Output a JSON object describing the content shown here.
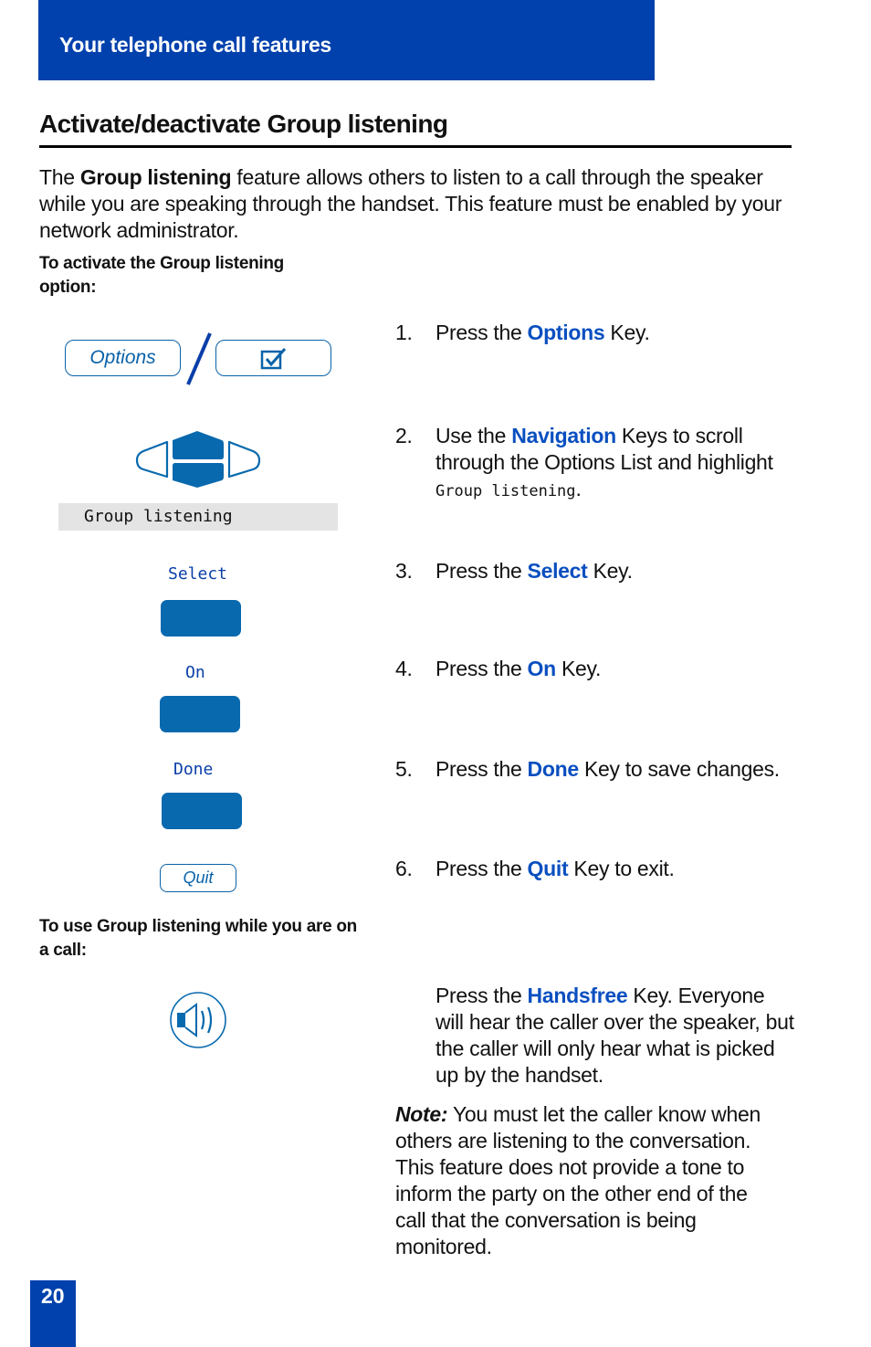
{
  "header": {
    "section": "Your telephone call features"
  },
  "page": {
    "title": "Activate/deactivate Group listening",
    "intro": {
      "pre": "The ",
      "bold": "Group listening",
      "post": " feature allows others to listen to a call through the speaker while you are speaking through the handset. This feature must be enabled by your network administrator."
    },
    "activate_heading": "To activate the Group listening option:",
    "during_call_heading": "To use Group listening while you are on a call:",
    "page_number": "20"
  },
  "illustrations": {
    "options_softkey": "Options",
    "display_line": "Group listening",
    "select_label": "Select",
    "on_label": "On",
    "done_label": "Done",
    "quit_softkey": "Quit"
  },
  "steps": [
    {
      "num": "1.",
      "pre": "Press the ",
      "key": "Options",
      "post": " Key."
    },
    {
      "num": "2.",
      "pre": "Use the ",
      "key": "Navigation",
      "post": " Keys to scroll through the Options List and highlight",
      "lcd": "Group listening",
      "lcd_post": "."
    },
    {
      "num": "3.",
      "pre": "Press the ",
      "key": "Select",
      "post": " Key."
    },
    {
      "num": "4.",
      "pre": "Press the ",
      "key": "On",
      "post": " Key."
    },
    {
      "num": "5.",
      "pre": "Press the ",
      "key": "Done",
      "post": " Key to save changes."
    },
    {
      "num": "6.",
      "pre": "Press the ",
      "key": "Quit",
      "post": " Key to exit."
    }
  ],
  "handsfree": {
    "pre": "Press the ",
    "key": "Handsfree",
    "post": " Key. Everyone will hear the caller over the speaker, but the caller will only hear what is picked up by the handset."
  },
  "note": {
    "label": "Note:",
    "text": " You must let the caller know when others are listening to the conversation. This feature does not provide a tone to inform the party on the other end of the call that the conversation is being monitored."
  },
  "colors": {
    "brand_blue": "#0041ad",
    "key_blue": "#0a4fc0",
    "icon_blue": "#0869ae"
  }
}
